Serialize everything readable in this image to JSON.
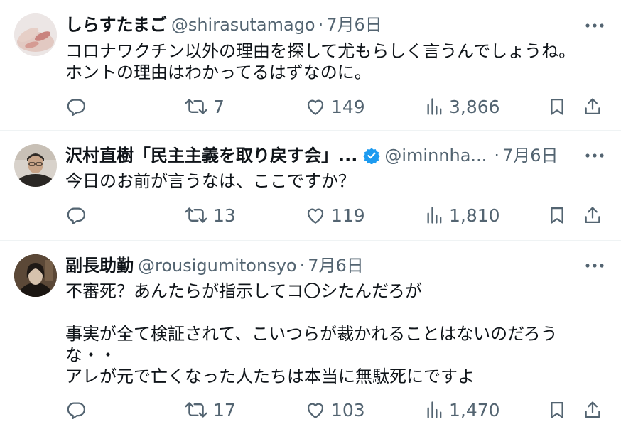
{
  "tweets": [
    {
      "name": "しらすたまご",
      "handle": "@shirasutamago",
      "dot": "·",
      "date": "7月6日",
      "verified": false,
      "text": "コロナワクチン以外の理由を探して尤もらしく言うんでしょうね。\nホントの理由はわかってるはずなのに。",
      "stats": {
        "replies": "",
        "retweets": "7",
        "likes": "149",
        "views": "3,866"
      }
    },
    {
      "name": "沢村直樹「民主主義を取り戻す会」...",
      "handle": "@iminnha...",
      "dot": "·",
      "date": "7月6日",
      "verified": true,
      "text": "今日のお前が言うなは、ここですか？",
      "stats": {
        "replies": "",
        "retweets": "13",
        "likes": "119",
        "views": "1,810"
      }
    },
    {
      "name": "副長助勤",
      "handle": "@rousigumitonsyo",
      "dot": "·",
      "date": "7月6日",
      "verified": false,
      "text": "不審死？あんたらが指示してコ〇シたんだろが\n\n事実が全て検証されて、こいつらが裁かれることはないのだろう\nな・・\nアレが元で亡くなった人たちは本当に無駄死にですよ",
      "stats": {
        "replies": "",
        "retweets": "17",
        "likes": "103",
        "views": "1,470"
      }
    }
  ],
  "colors": {
    "text": "#0f1419",
    "muted": "#536471",
    "divider": "#eff3f4",
    "verified": "#1d9bf0"
  },
  "icons": [
    "more-icon",
    "reply-icon",
    "retweet-icon",
    "like-icon",
    "views-icon",
    "bookmark-icon",
    "share-icon",
    "verified-icon"
  ]
}
